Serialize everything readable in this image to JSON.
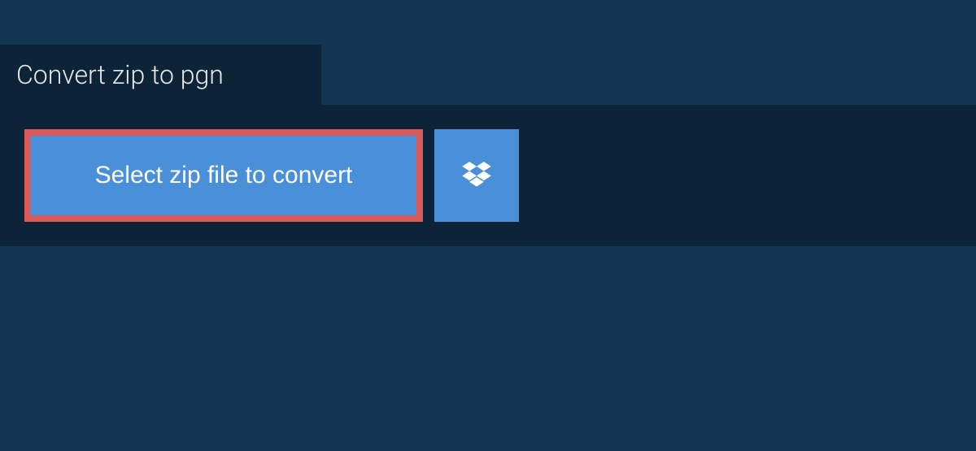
{
  "tab": {
    "title": "Convert zip to pgn"
  },
  "buttons": {
    "select_label": "Select zip file to convert"
  },
  "colors": {
    "background": "#123651",
    "panel": "#0d2438",
    "button": "#4a90d9",
    "highlight_border": "#d85a5a"
  }
}
